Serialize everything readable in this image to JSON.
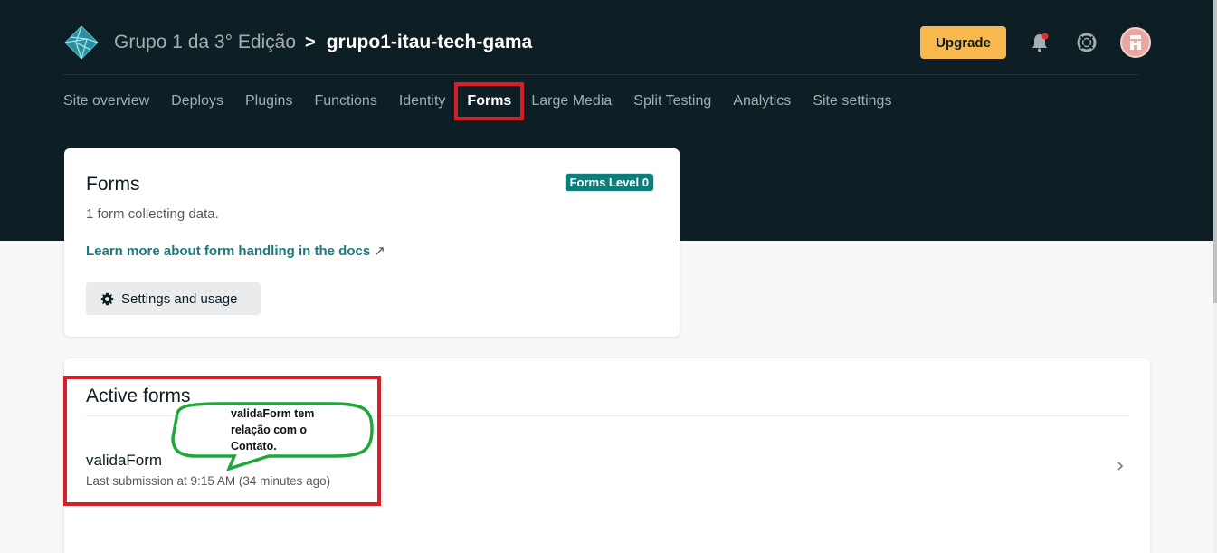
{
  "header": {
    "team_name": "Grupo 1 da 3° Edição",
    "separator": ">",
    "site_name": "grupo1-itau-tech-gama",
    "upgrade_label": "Upgrade",
    "icons": [
      "bell-icon",
      "help-lifebuoy-icon",
      "avatar"
    ],
    "notification_dot_color": "#e02e2e"
  },
  "nav": {
    "items": [
      {
        "label": "Site overview"
      },
      {
        "label": "Deploys"
      },
      {
        "label": "Plugins"
      },
      {
        "label": "Functions"
      },
      {
        "label": "Identity"
      },
      {
        "label": "Forms",
        "active": true
      },
      {
        "label": "Large Media"
      },
      {
        "label": "Split Testing"
      },
      {
        "label": "Analytics"
      },
      {
        "label": "Site settings"
      }
    ]
  },
  "forms_card": {
    "title": "Forms",
    "badge": "Forms Level 0",
    "subtitle": "1 form collecting data.",
    "docs_link": "Learn more about form handling in the docs",
    "docs_link_arrow": "↗",
    "settings_button": "Settings and usage"
  },
  "active_forms": {
    "title": "Active forms",
    "forms": [
      {
        "name": "validaForm",
        "meta": "Last submission at 9:15 AM (34 minutes ago)"
      }
    ]
  },
  "annotation": {
    "text": "validaForm tem relação com o Contato.",
    "highlight_color": "#d71f27",
    "bubble_color": "#1fa83a"
  },
  "colors": {
    "header_bg": "#0e1e25",
    "accent_teal": "#0f7d7a",
    "upgrade": "#f8b84e"
  }
}
